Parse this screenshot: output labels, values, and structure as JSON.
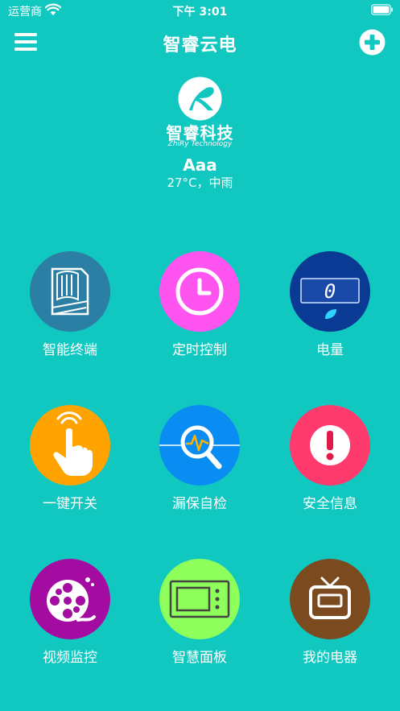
{
  "status_bar": {
    "carrier": "运营商",
    "time": "下午 3:01"
  },
  "nav": {
    "title": "智睿云电"
  },
  "logo": {
    "title": "智睿科技",
    "subtitle": "ZhiRy Technology"
  },
  "user": {
    "name": "Aaa",
    "weather": "27°C，中雨"
  },
  "grid": [
    {
      "label": "智能终端",
      "icon": "terminal-icon",
      "color": "#2b7fa4"
    },
    {
      "label": "定时控制",
      "icon": "clock-icon",
      "color": "#ff54f0"
    },
    {
      "label": "电量",
      "icon": "meter-icon",
      "color": "#0a3a94",
      "meter_value": "0"
    },
    {
      "label": "一键开关",
      "icon": "tap-hand-icon",
      "color": "#ffa300"
    },
    {
      "label": "漏保自检",
      "icon": "magnifier-pulse-icon",
      "color": "#0a8df2"
    },
    {
      "label": "安全信息",
      "icon": "alert-icon",
      "color": "#ff3a6c"
    },
    {
      "label": "视频监控",
      "icon": "film-reel-icon",
      "color": "#a40ba0"
    },
    {
      "label": "智慧面板",
      "icon": "panel-icon",
      "color": "#8fff5c"
    },
    {
      "label": "我的电器",
      "icon": "tv-icon",
      "color": "#7b4a1f"
    }
  ]
}
